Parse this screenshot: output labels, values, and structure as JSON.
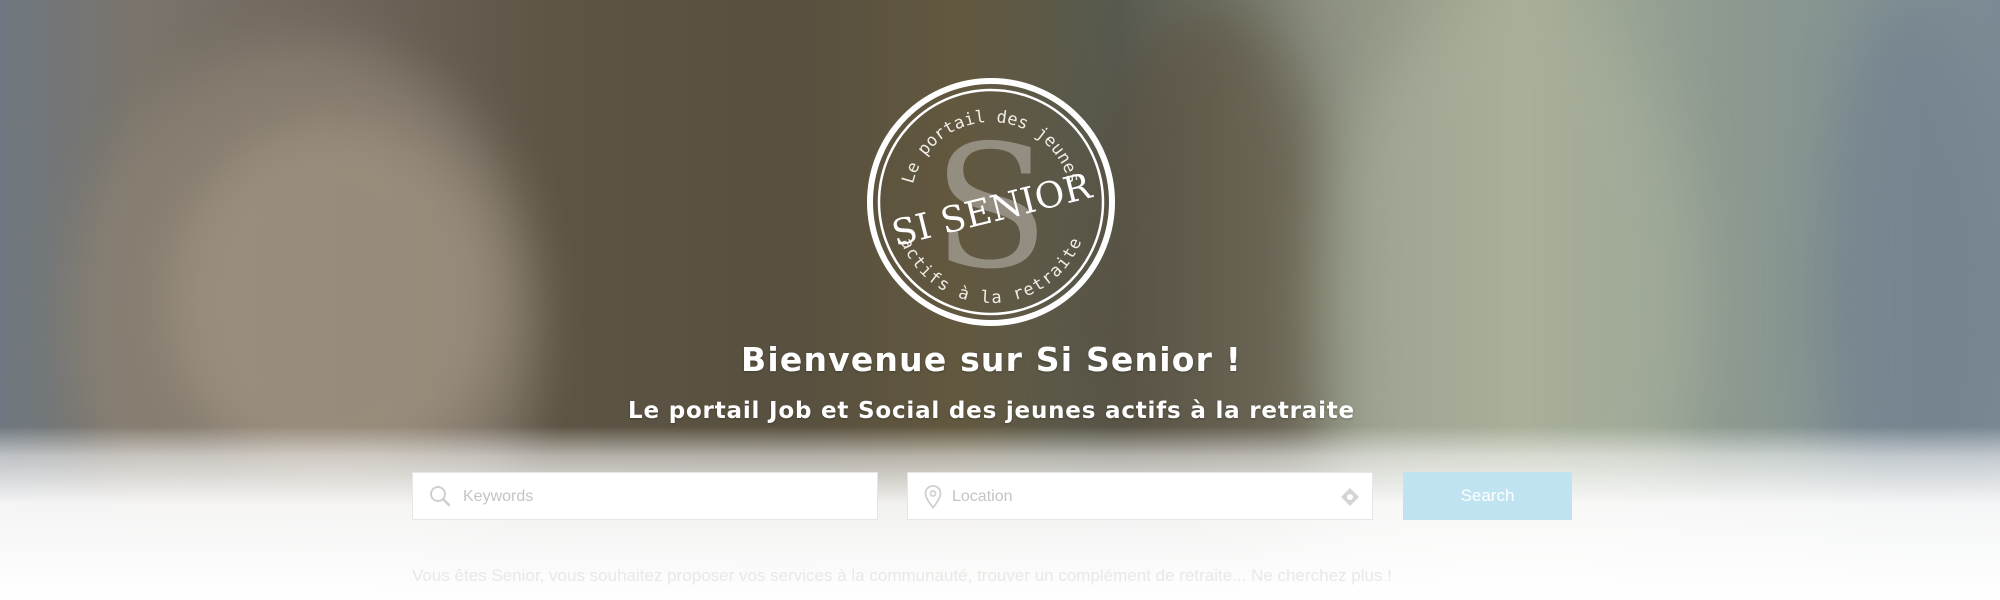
{
  "brand": {
    "logo_main": "SI SENIOR",
    "logo_top": "Le portail des jeunes",
    "logo_bottom": "actifs à la retraite",
    "logo_letter": "S"
  },
  "hero": {
    "title": "Bienvenue sur Si Senior !",
    "subtitle": "Le portail Job et Social des jeunes actifs à la retraite"
  },
  "search": {
    "keywords_placeholder": "Keywords",
    "location_placeholder": "Location",
    "button_label": "Search",
    "button_color": "#bfe3f0"
  },
  "intro": {
    "text": "Vous êtes Senior, vous souhaitez proposer vos services à la communauté, trouver un complément de retraite... Ne cherchez plus !"
  },
  "icons": {
    "keywords": "search-icon",
    "location": "map-pin-icon",
    "locate": "locate-me-icon"
  }
}
